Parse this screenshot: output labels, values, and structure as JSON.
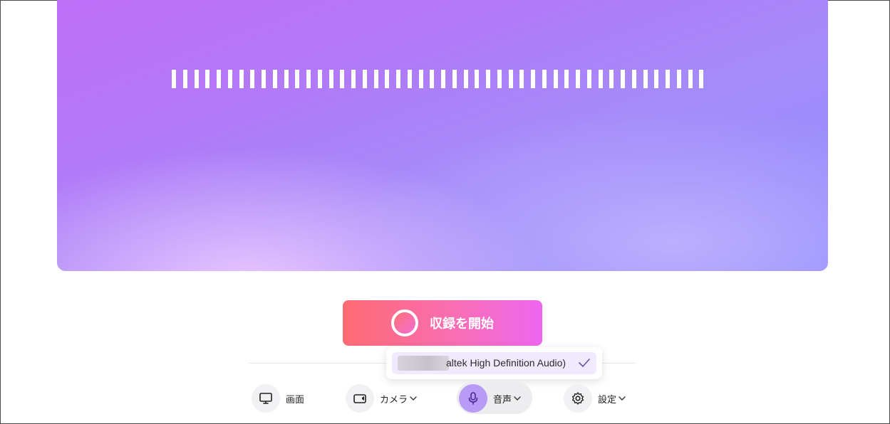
{
  "recording": {
    "start_label": "収録を開始"
  },
  "audio_device_menu": {
    "items": [
      {
        "label": "altek High Definition Audio)",
        "selected": true
      }
    ]
  },
  "toolbar": {
    "items": [
      {
        "label": "画面",
        "icon": "monitor-icon"
      },
      {
        "label": "カメラ",
        "icon": "camera-icon"
      },
      {
        "label": "音声",
        "icon": "microphone-icon"
      },
      {
        "label": "設定",
        "icon": "gear-icon"
      }
    ]
  },
  "colors": {
    "record_start": "#ff6a72",
    "record_end": "#ee66f0",
    "accent_purple": "#b89bf6"
  }
}
